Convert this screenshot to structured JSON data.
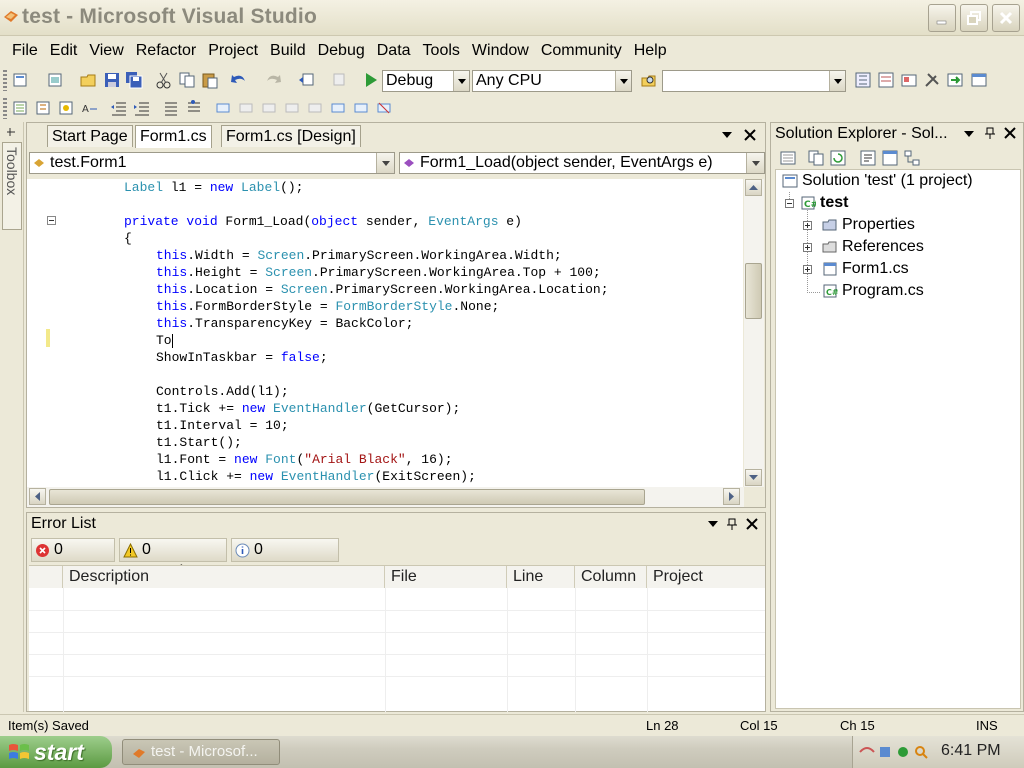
{
  "window": {
    "title": "test - Microsoft Visual Studio"
  },
  "menu": [
    "File",
    "Edit",
    "View",
    "Refactor",
    "Project",
    "Build",
    "Debug",
    "Data",
    "Tools",
    "Window",
    "Community",
    "Help"
  ],
  "toolbar": {
    "config": "Debug",
    "platform": "Any CPU",
    "find": ""
  },
  "editor": {
    "tabs": [
      "Start Page",
      "Form1.cs",
      "Form1.cs [Design]"
    ],
    "class_combo": "test.Form1",
    "member_combo": "Form1_Load(object sender, EventArgs e)",
    "lines": [
      "Label l1 = new Label();",
      "",
      "private void Form1_Load(object sender, EventArgs e)",
      "{",
      "this.Width = Screen.PrimaryScreen.WorkingArea.Width;",
      "this.Height = Screen.PrimaryScreen.WorkingArea.Top + 100;",
      "this.Location = Screen.PrimaryScreen.WorkingArea.Location;",
      "this.FormBorderStyle = FormBorderStyle.None;",
      "this.TransparencyKey = BackColor;",
      "To",
      "ShowInTaskbar = false;",
      "",
      "Controls.Add(l1);",
      "t1.Tick += new EventHandler(GetCursor);",
      "t1.Interval = 10;",
      "t1.Start();",
      "l1.Font = new Font(\"Arial Black\", 16);",
      "l1.Click += new EventHandler(ExitScreen);"
    ]
  },
  "error_list": {
    "title": "Error List",
    "errors": "0 Errors",
    "warnings": "0 Warnings",
    "messages": "0 Messages",
    "columns": [
      "Description",
      "File",
      "Line",
      "Column",
      "Project"
    ]
  },
  "toolbox_label": "Toolbox",
  "solution_explorer": {
    "title": "Solution Explorer - Sol...",
    "solution": "Solution 'test' (1 project)",
    "project": "test",
    "items": [
      "Properties",
      "References",
      "Form1.cs",
      "Program.cs"
    ]
  },
  "status": {
    "message": "Item(s) Saved",
    "line": "Ln 28",
    "col": "Col 15",
    "ch": "Ch 15",
    "mode": "INS"
  },
  "taskbar": {
    "start": "start",
    "task": "test - Microsof...",
    "clock": "6:41 PM"
  }
}
